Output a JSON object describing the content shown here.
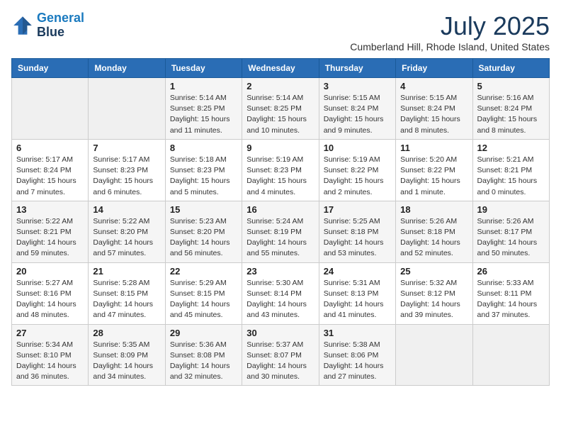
{
  "header": {
    "logo_line1": "General",
    "logo_line2": "Blue",
    "month": "July 2025",
    "location": "Cumberland Hill, Rhode Island, United States"
  },
  "weekdays": [
    "Sunday",
    "Monday",
    "Tuesday",
    "Wednesday",
    "Thursday",
    "Friday",
    "Saturday"
  ],
  "weeks": [
    [
      {
        "day": "",
        "info": ""
      },
      {
        "day": "",
        "info": ""
      },
      {
        "day": "1",
        "info": "Sunrise: 5:14 AM\nSunset: 8:25 PM\nDaylight: 15 hours\nand 11 minutes."
      },
      {
        "day": "2",
        "info": "Sunrise: 5:14 AM\nSunset: 8:25 PM\nDaylight: 15 hours\nand 10 minutes."
      },
      {
        "day": "3",
        "info": "Sunrise: 5:15 AM\nSunset: 8:24 PM\nDaylight: 15 hours\nand 9 minutes."
      },
      {
        "day": "4",
        "info": "Sunrise: 5:15 AM\nSunset: 8:24 PM\nDaylight: 15 hours\nand 8 minutes."
      },
      {
        "day": "5",
        "info": "Sunrise: 5:16 AM\nSunset: 8:24 PM\nDaylight: 15 hours\nand 8 minutes."
      }
    ],
    [
      {
        "day": "6",
        "info": "Sunrise: 5:17 AM\nSunset: 8:24 PM\nDaylight: 15 hours\nand 7 minutes."
      },
      {
        "day": "7",
        "info": "Sunrise: 5:17 AM\nSunset: 8:23 PM\nDaylight: 15 hours\nand 6 minutes."
      },
      {
        "day": "8",
        "info": "Sunrise: 5:18 AM\nSunset: 8:23 PM\nDaylight: 15 hours\nand 5 minutes."
      },
      {
        "day": "9",
        "info": "Sunrise: 5:19 AM\nSunset: 8:23 PM\nDaylight: 15 hours\nand 4 minutes."
      },
      {
        "day": "10",
        "info": "Sunrise: 5:19 AM\nSunset: 8:22 PM\nDaylight: 15 hours\nand 2 minutes."
      },
      {
        "day": "11",
        "info": "Sunrise: 5:20 AM\nSunset: 8:22 PM\nDaylight: 15 hours\nand 1 minute."
      },
      {
        "day": "12",
        "info": "Sunrise: 5:21 AM\nSunset: 8:21 PM\nDaylight: 15 hours\nand 0 minutes."
      }
    ],
    [
      {
        "day": "13",
        "info": "Sunrise: 5:22 AM\nSunset: 8:21 PM\nDaylight: 14 hours\nand 59 minutes."
      },
      {
        "day": "14",
        "info": "Sunrise: 5:22 AM\nSunset: 8:20 PM\nDaylight: 14 hours\nand 57 minutes."
      },
      {
        "day": "15",
        "info": "Sunrise: 5:23 AM\nSunset: 8:20 PM\nDaylight: 14 hours\nand 56 minutes."
      },
      {
        "day": "16",
        "info": "Sunrise: 5:24 AM\nSunset: 8:19 PM\nDaylight: 14 hours\nand 55 minutes."
      },
      {
        "day": "17",
        "info": "Sunrise: 5:25 AM\nSunset: 8:18 PM\nDaylight: 14 hours\nand 53 minutes."
      },
      {
        "day": "18",
        "info": "Sunrise: 5:26 AM\nSunset: 8:18 PM\nDaylight: 14 hours\nand 52 minutes."
      },
      {
        "day": "19",
        "info": "Sunrise: 5:26 AM\nSunset: 8:17 PM\nDaylight: 14 hours\nand 50 minutes."
      }
    ],
    [
      {
        "day": "20",
        "info": "Sunrise: 5:27 AM\nSunset: 8:16 PM\nDaylight: 14 hours\nand 48 minutes."
      },
      {
        "day": "21",
        "info": "Sunrise: 5:28 AM\nSunset: 8:15 PM\nDaylight: 14 hours\nand 47 minutes."
      },
      {
        "day": "22",
        "info": "Sunrise: 5:29 AM\nSunset: 8:15 PM\nDaylight: 14 hours\nand 45 minutes."
      },
      {
        "day": "23",
        "info": "Sunrise: 5:30 AM\nSunset: 8:14 PM\nDaylight: 14 hours\nand 43 minutes."
      },
      {
        "day": "24",
        "info": "Sunrise: 5:31 AM\nSunset: 8:13 PM\nDaylight: 14 hours\nand 41 minutes."
      },
      {
        "day": "25",
        "info": "Sunrise: 5:32 AM\nSunset: 8:12 PM\nDaylight: 14 hours\nand 39 minutes."
      },
      {
        "day": "26",
        "info": "Sunrise: 5:33 AM\nSunset: 8:11 PM\nDaylight: 14 hours\nand 37 minutes."
      }
    ],
    [
      {
        "day": "27",
        "info": "Sunrise: 5:34 AM\nSunset: 8:10 PM\nDaylight: 14 hours\nand 36 minutes."
      },
      {
        "day": "28",
        "info": "Sunrise: 5:35 AM\nSunset: 8:09 PM\nDaylight: 14 hours\nand 34 minutes."
      },
      {
        "day": "29",
        "info": "Sunrise: 5:36 AM\nSunset: 8:08 PM\nDaylight: 14 hours\nand 32 minutes."
      },
      {
        "day": "30",
        "info": "Sunrise: 5:37 AM\nSunset: 8:07 PM\nDaylight: 14 hours\nand 30 minutes."
      },
      {
        "day": "31",
        "info": "Sunrise: 5:38 AM\nSunset: 8:06 PM\nDaylight: 14 hours\nand 27 minutes."
      },
      {
        "day": "",
        "info": ""
      },
      {
        "day": "",
        "info": ""
      }
    ]
  ]
}
